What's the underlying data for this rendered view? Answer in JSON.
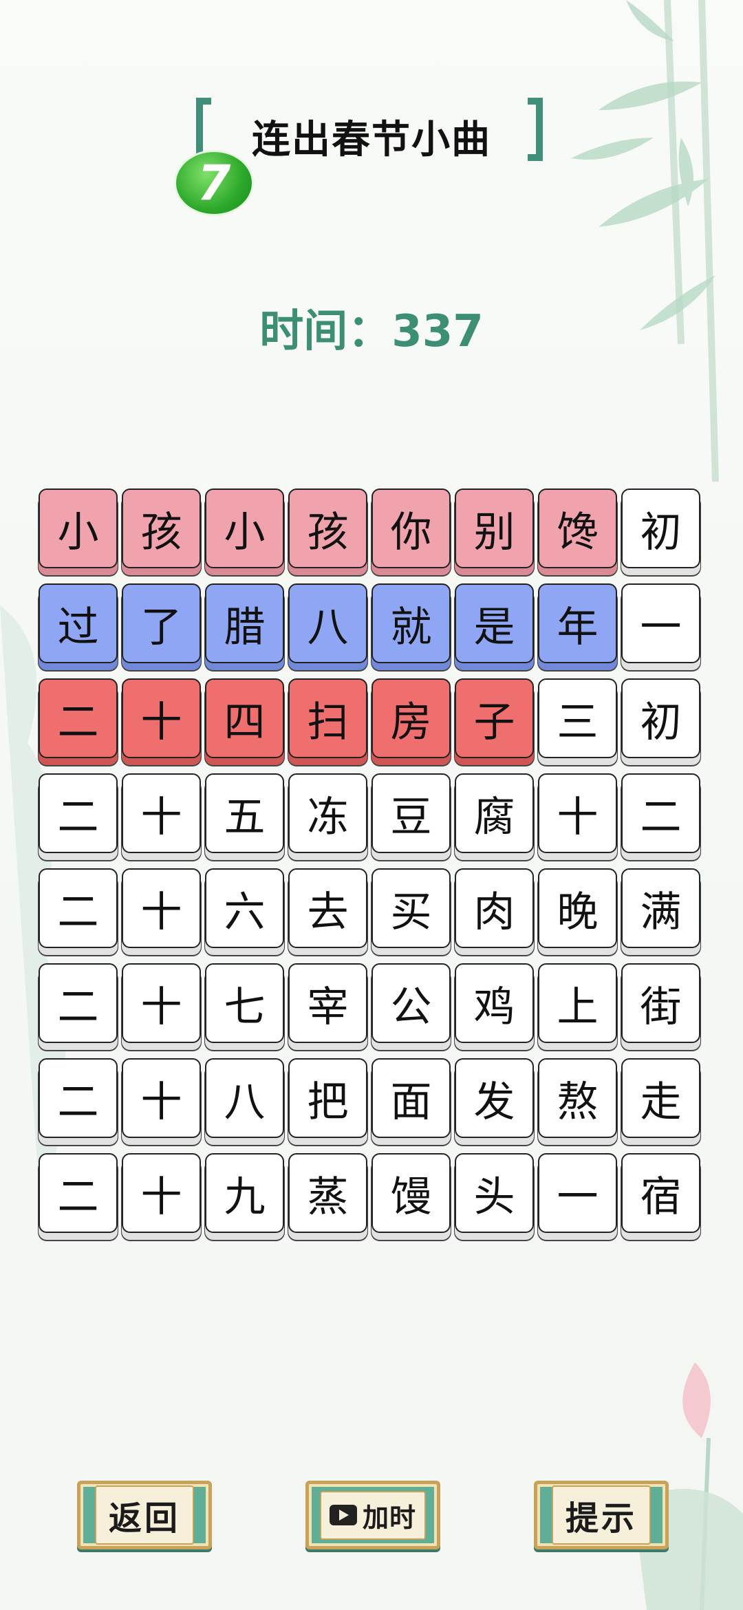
{
  "title": "连出春节小曲",
  "level_badge": "7",
  "timer": {
    "label": "时间：",
    "value": "337"
  },
  "grid": [
    [
      {
        "c": "小",
        "s": "pink"
      },
      {
        "c": "孩",
        "s": "pink"
      },
      {
        "c": "小",
        "s": "pink"
      },
      {
        "c": "孩",
        "s": "pink"
      },
      {
        "c": "你",
        "s": "pink"
      },
      {
        "c": "别",
        "s": "pink"
      },
      {
        "c": "馋",
        "s": "pink"
      },
      {
        "c": "初",
        "s": "white"
      }
    ],
    [
      {
        "c": "过",
        "s": "blue"
      },
      {
        "c": "了",
        "s": "blue"
      },
      {
        "c": "腊",
        "s": "blue"
      },
      {
        "c": "八",
        "s": "blue"
      },
      {
        "c": "就",
        "s": "blue"
      },
      {
        "c": "是",
        "s": "blue"
      },
      {
        "c": "年",
        "s": "blue"
      },
      {
        "c": "一",
        "s": "white"
      }
    ],
    [
      {
        "c": "二",
        "s": "red"
      },
      {
        "c": "十",
        "s": "red"
      },
      {
        "c": "四",
        "s": "red"
      },
      {
        "c": "扫",
        "s": "red"
      },
      {
        "c": "房",
        "s": "red"
      },
      {
        "c": "子",
        "s": "red"
      },
      {
        "c": "三",
        "s": "white"
      },
      {
        "c": "初",
        "s": "white"
      }
    ],
    [
      {
        "c": "二",
        "s": "white"
      },
      {
        "c": "十",
        "s": "white"
      },
      {
        "c": "五",
        "s": "white"
      },
      {
        "c": "冻",
        "s": "white"
      },
      {
        "c": "豆",
        "s": "white"
      },
      {
        "c": "腐",
        "s": "white"
      },
      {
        "c": "十",
        "s": "white"
      },
      {
        "c": "二",
        "s": "white"
      }
    ],
    [
      {
        "c": "二",
        "s": "white"
      },
      {
        "c": "十",
        "s": "white"
      },
      {
        "c": "六",
        "s": "white"
      },
      {
        "c": "去",
        "s": "white"
      },
      {
        "c": "买",
        "s": "white"
      },
      {
        "c": "肉",
        "s": "white"
      },
      {
        "c": "晚",
        "s": "white"
      },
      {
        "c": "满",
        "s": "white"
      }
    ],
    [
      {
        "c": "二",
        "s": "white"
      },
      {
        "c": "十",
        "s": "white"
      },
      {
        "c": "七",
        "s": "white"
      },
      {
        "c": "宰",
        "s": "white"
      },
      {
        "c": "公",
        "s": "white"
      },
      {
        "c": "鸡",
        "s": "white"
      },
      {
        "c": "上",
        "s": "white"
      },
      {
        "c": "街",
        "s": "white"
      }
    ],
    [
      {
        "c": "二",
        "s": "white"
      },
      {
        "c": "十",
        "s": "white"
      },
      {
        "c": "八",
        "s": "white"
      },
      {
        "c": "把",
        "s": "white"
      },
      {
        "c": "面",
        "s": "white"
      },
      {
        "c": "发",
        "s": "white"
      },
      {
        "c": "熬",
        "s": "white"
      },
      {
        "c": "走",
        "s": "white"
      }
    ],
    [
      {
        "c": "二",
        "s": "white"
      },
      {
        "c": "十",
        "s": "white"
      },
      {
        "c": "九",
        "s": "white"
      },
      {
        "c": "蒸",
        "s": "white"
      },
      {
        "c": "馒",
        "s": "white"
      },
      {
        "c": "头",
        "s": "white"
      },
      {
        "c": "一",
        "s": "white"
      },
      {
        "c": "宿",
        "s": "white"
      }
    ]
  ],
  "buttons": {
    "back": "返回",
    "add_time": "加时",
    "hint": "提示"
  },
  "colors": {
    "accent": "#3c8f74",
    "pink": "#f0a3ad",
    "blue": "#8ea6f4",
    "red": "#ef6e6e"
  },
  "icons": {
    "add_time": "video-icon"
  }
}
